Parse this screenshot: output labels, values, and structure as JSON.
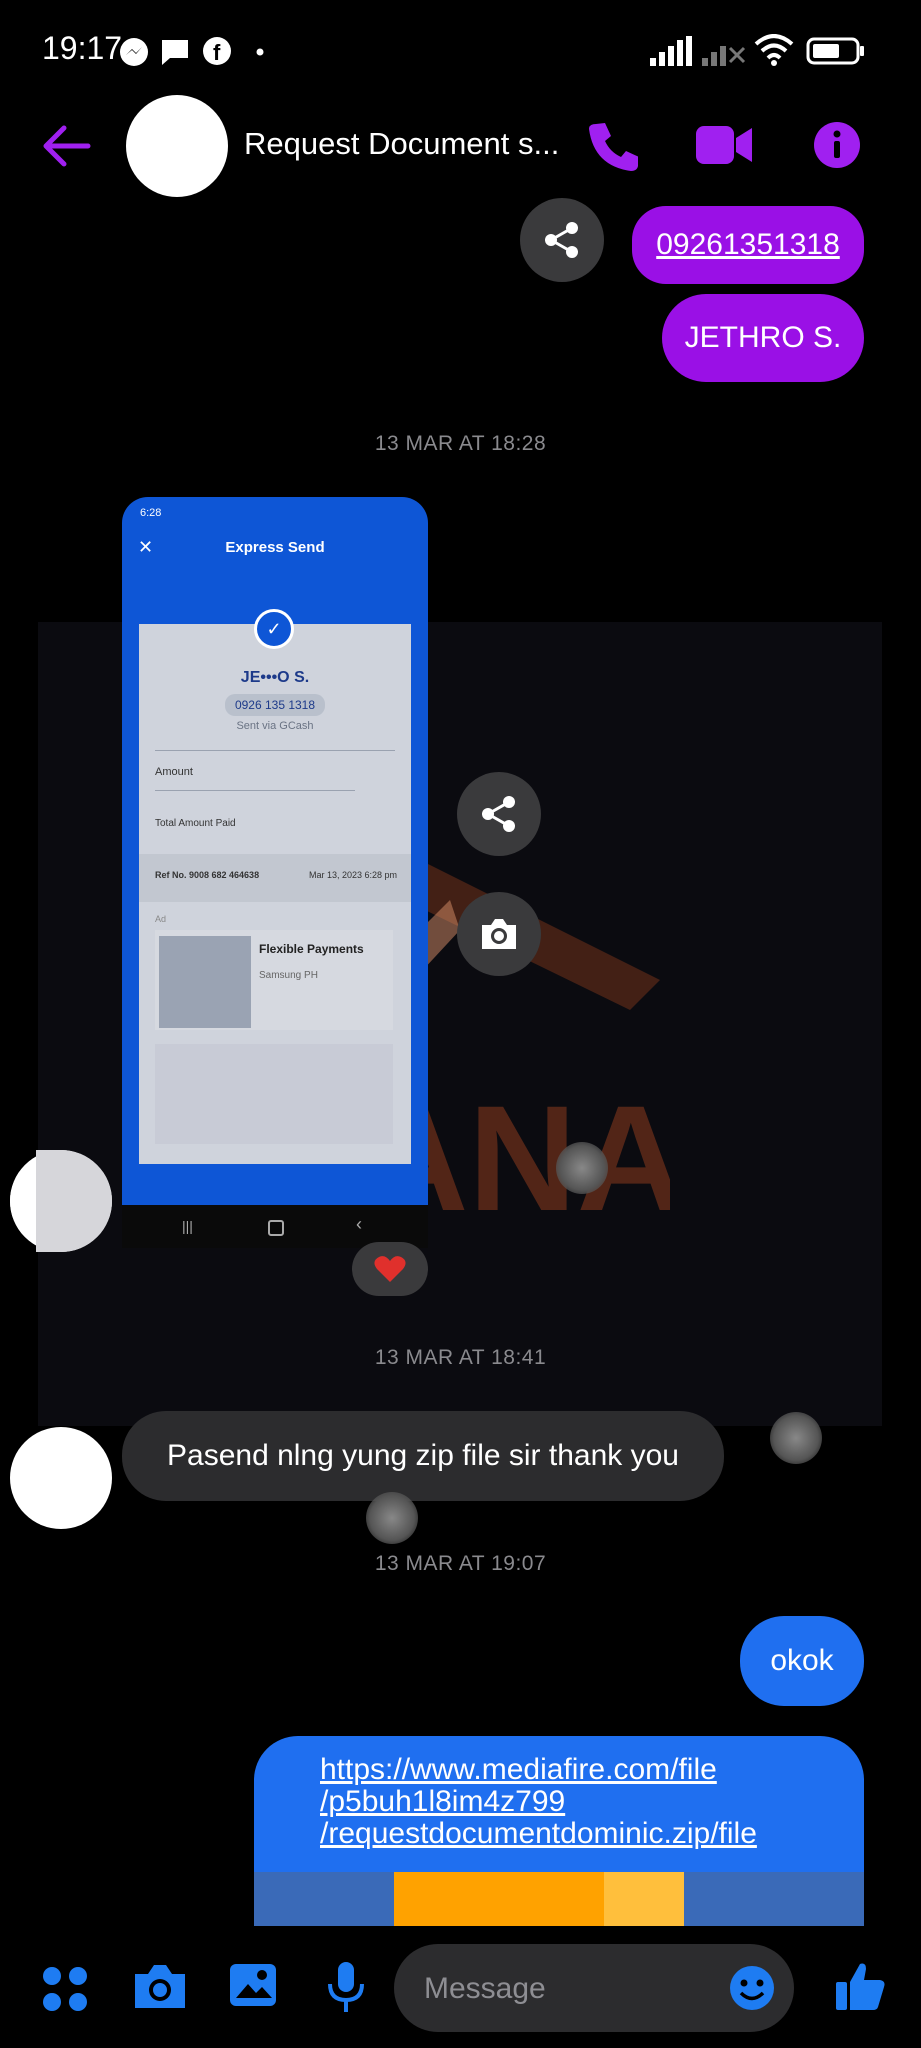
{
  "status": {
    "time": "19:17"
  },
  "header": {
    "title": "Request Document s..."
  },
  "messages": {
    "phone_link": "09261351318",
    "name_bubble": "JETHRO S.",
    "ts1": "13 MAR AT 18:28",
    "ts2": "13 MAR AT 18:41",
    "incoming_text": "Pasend nlng yung zip file sir thank you",
    "ts3": "13 MAR AT 19:07",
    "okok": "okok",
    "link_line1": "https://www.mediafire.com/file",
    "link_line2": "/p5buh1l8im4z799",
    "link_line3": "/requestdocumentdominic.zip/file"
  },
  "receipt": {
    "status_time": "6:28",
    "title": "Express Send",
    "recipient": "JE•••O S.",
    "number": "0926 135 1318",
    "sent_via": "Sent via GCash",
    "amount_label": "Amount",
    "total_label": "Total Amount Paid",
    "ref_label": "Ref No. 9008 682 464638",
    "date": "Mar 13, 2023 6:28 pm",
    "ad_label": "Ad",
    "ad_title": "Flexible Payments",
    "ad_sub": "Samsung PH"
  },
  "watermark": "SANARA",
  "composer": {
    "placeholder": "Message"
  },
  "colors": {
    "purple": "#9a10e6",
    "blue": "#1f6ff0",
    "icon_purple": "#a020f0",
    "icon_blue": "#1e7cf2"
  }
}
